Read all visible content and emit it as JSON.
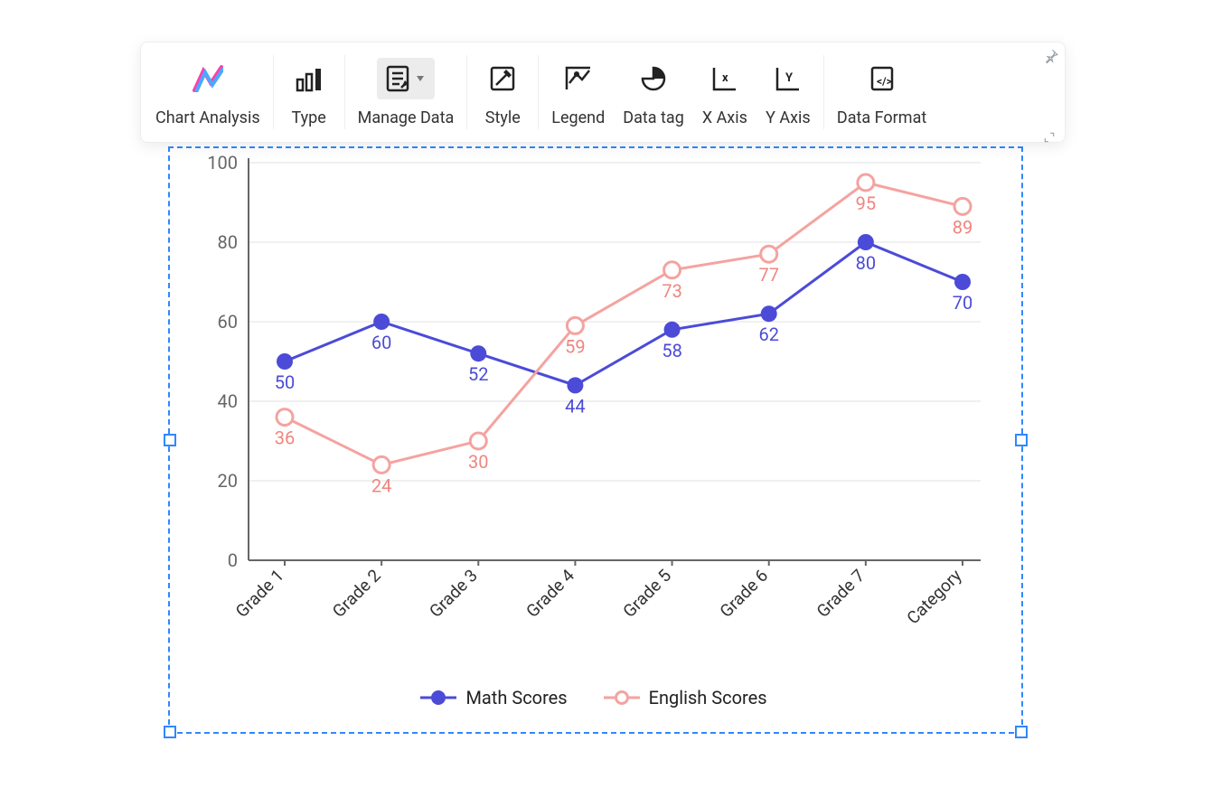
{
  "toolbar": {
    "items": [
      {
        "id": "chart-analysis",
        "label": "Chart Analysis"
      },
      {
        "id": "type",
        "label": "Type"
      },
      {
        "id": "manage-data",
        "label": "Manage Data",
        "active": true
      },
      {
        "id": "style",
        "label": "Style"
      },
      {
        "id": "legend",
        "label": "Legend"
      },
      {
        "id": "data-tag",
        "label": "Data tag"
      },
      {
        "id": "x-axis",
        "label": "X Axis"
      },
      {
        "id": "y-axis",
        "label": "Y Axis"
      },
      {
        "id": "data-format",
        "label": "Data Format"
      }
    ]
  },
  "colors": {
    "axis": "#666",
    "grid": "#e0e0e0",
    "tick_label": "#666",
    "math": {
      "line": "#4b4bd8",
      "fill": "#4b4bd8",
      "label": "#4b4bd8"
    },
    "english": {
      "line": "#f4a3a0",
      "fill": "#ffffff",
      "stroke": "#f4a3a0",
      "label": "#f0857f"
    }
  },
  "chart_data": {
    "type": "line",
    "categories": [
      "Grade 1",
      "Grade 2",
      "Grade 3",
      "Grade 4",
      "Grade 5",
      "Grade 6",
      "Grade 7",
      "Category"
    ],
    "ylim": [
      0,
      100
    ],
    "yticks": [
      0,
      20,
      40,
      60,
      80,
      100
    ],
    "series": [
      {
        "name": "Math Scores",
        "key": "math",
        "marker": "filled",
        "values": [
          50,
          60,
          52,
          44,
          58,
          62,
          80,
          70
        ]
      },
      {
        "name": "English Scores",
        "key": "english",
        "marker": "hollow",
        "values": [
          36,
          24,
          30,
          59,
          73,
          77,
          95,
          89
        ]
      }
    ],
    "xlabel": "",
    "ylabel": "",
    "title": "",
    "legend_position": "bottom",
    "grid": true
  }
}
